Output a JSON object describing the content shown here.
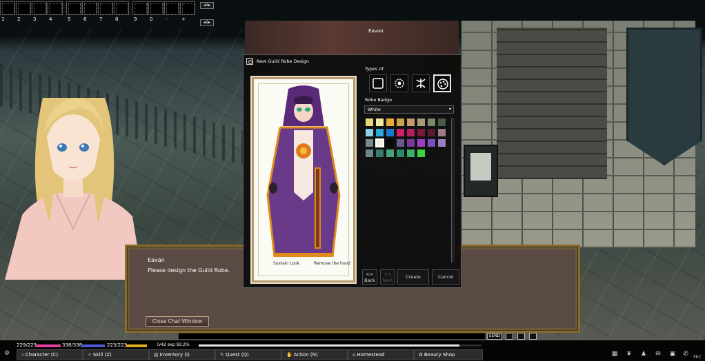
{
  "hotbar": {
    "slot_numbers": [
      "1",
      "2",
      "3",
      "4",
      "5",
      "6",
      "7",
      "8",
      "9",
      "0",
      "-",
      "+"
    ],
    "page_indicator_1": "1",
    "page_indicator_2": "1"
  },
  "scene": {
    "npc_name": "Eavan"
  },
  "robe_window": {
    "title": "New Guild Robe Design",
    "types_label": "Types of",
    "type_icons": [
      "square-icon",
      "emblem-icon",
      "crossed-icon",
      "palette-icon"
    ],
    "selected_type": 3,
    "badge_label": "Robe Badge",
    "badge_value": "White",
    "preview_left_label": "Sustain Look",
    "preview_right_label": "Remove the hood",
    "swatch_colors": [
      "#e8d87a",
      "#f0e89a",
      "#e8a83a",
      "#cfa24a",
      "#c99a6a",
      "#a89a7a",
      "#7a8a6a",
      "#4a5a4a",
      "#8ad0e8",
      "#2aa8e0",
      "#1a7ad0",
      "#d0206a",
      "#b0205a",
      "#7a1a3a",
      "#5a1a2a",
      "#a07a8a",
      "#7a8a8a",
      "#f0f0e0",
      "#0a0a0a",
      "#6a5a8a",
      "#7a3a9a",
      "#9a40c0",
      "#7a50c0",
      "#9a80c0",
      "#6a8a8a",
      "#3a7a6a",
      "#4aa07a",
      "#2a8a6a",
      "#3ab06a",
      "#40d040"
    ],
    "selected_swatch": 17,
    "buttons": {
      "back": "<<\nBack",
      "next": ">>\nNext",
      "create": "Create",
      "cancel": "Cancel"
    }
  },
  "chat": {
    "speaker": "Eavan",
    "message": "Please design the Guild Robe.",
    "close_label": "Close Chat Window"
  },
  "hud": {
    "hp": "229/229",
    "mp": "338/338",
    "sp": "223/223",
    "level_text": "lv42 exp 92.2%",
    "exp_fraction": 0.922,
    "send_label": "SEND",
    "menus": [
      {
        "icon": "search-icon",
        "label": "Character (C)"
      },
      {
        "icon": "skill-icon",
        "label": "Skill (Z)"
      },
      {
        "icon": "bag-icon",
        "label": "Inventory (I)"
      },
      {
        "icon": "quest-icon",
        "label": "Quest (Q)"
      },
      {
        "icon": "action-icon",
        "label": "Action (N)"
      },
      {
        "icon": "house-icon",
        "label": "Homestead"
      },
      {
        "icon": "shop-icon",
        "label": "Beauty Shop"
      }
    ],
    "hp_color": "#e0409a",
    "mp_color": "#4a5ad0",
    "sp_color": "#e0b020",
    "fec_label": "FEC"
  }
}
